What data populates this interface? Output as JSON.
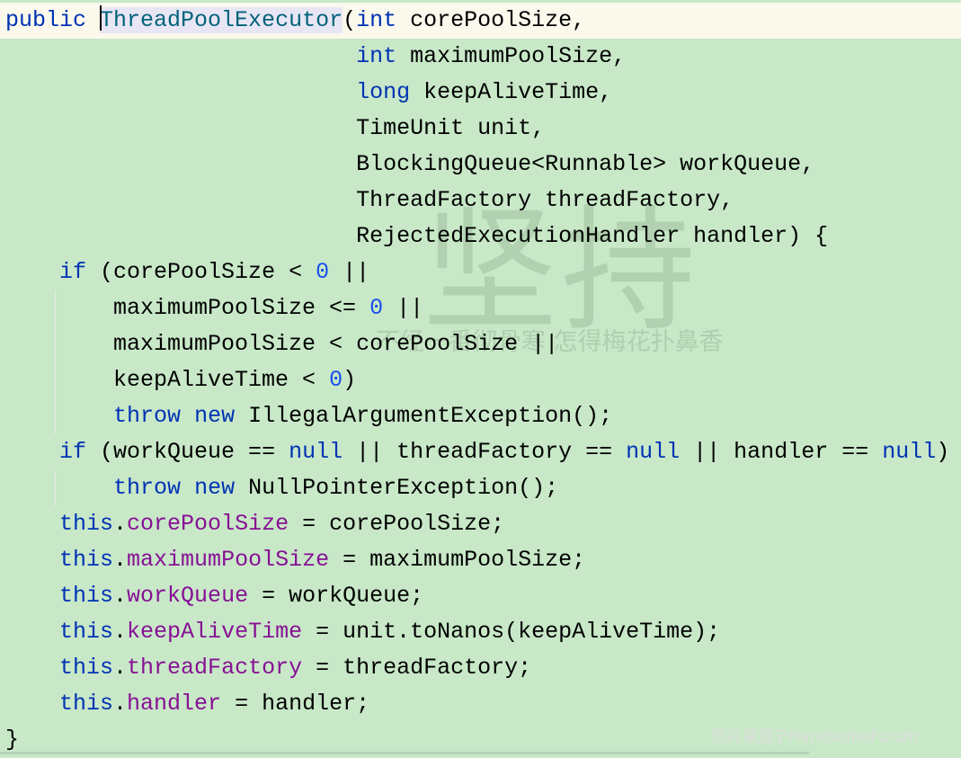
{
  "colors": {
    "background": "#c8e8c8",
    "current_line": "#fbf8ec",
    "selection": "#e8e6f4",
    "keyword": "#0033b3",
    "class_name": "#00627a",
    "number": "#1750eb",
    "field": "#871094"
  },
  "watermark": {
    "big": "坚持",
    "poem": "不经一番彻骨寒 怎得梅花扑鼻香",
    "source": "图片来源于HandsomeForum"
  },
  "code": [
    [
      {
        "t": "public",
        "c": "kw"
      },
      {
        "t": " "
      },
      {
        "t": "",
        "c": "caret"
      },
      {
        "t": "ThreadPoolExecutor",
        "c": "cls sel"
      },
      {
        "t": "("
      },
      {
        "t": "int",
        "c": "kw"
      },
      {
        "t": " corePoolSize,"
      }
    ],
    [
      {
        "t": "                          "
      },
      {
        "t": "int",
        "c": "kw"
      },
      {
        "t": " maximumPoolSize,"
      }
    ],
    [
      {
        "t": "                          "
      },
      {
        "t": "long",
        "c": "kw"
      },
      {
        "t": " keepAliveTime,"
      }
    ],
    [
      {
        "t": "                          TimeUnit unit,"
      }
    ],
    [
      {
        "t": "                          BlockingQueue<Runnable> workQueue,"
      }
    ],
    [
      {
        "t": "                          ThreadFactory threadFactory,"
      }
    ],
    [
      {
        "t": "                          RejectedExecutionHandler handler) {"
      }
    ],
    [
      {
        "t": "    "
      },
      {
        "t": "if",
        "c": "kw"
      },
      {
        "t": " (corePoolSize < "
      },
      {
        "t": "0",
        "c": "num"
      },
      {
        "t": " ||"
      }
    ],
    [
      {
        "t": "        maximumPoolSize <= "
      },
      {
        "t": "0",
        "c": "num"
      },
      {
        "t": " ||"
      }
    ],
    [
      {
        "t": "        maximumPoolSize < corePoolSize ||"
      }
    ],
    [
      {
        "t": "        keepAliveTime < "
      },
      {
        "t": "0",
        "c": "num"
      },
      {
        "t": ")"
      }
    ],
    [
      {
        "t": "        "
      },
      {
        "t": "throw",
        "c": "kw"
      },
      {
        "t": " "
      },
      {
        "t": "new",
        "c": "kw"
      },
      {
        "t": " IllegalArgumentException();"
      }
    ],
    [
      {
        "t": "    "
      },
      {
        "t": "if",
        "c": "kw"
      },
      {
        "t": " (workQueue == "
      },
      {
        "t": "null",
        "c": "kw"
      },
      {
        "t": " || threadFactory == "
      },
      {
        "t": "null",
        "c": "kw"
      },
      {
        "t": " || handler == "
      },
      {
        "t": "null",
        "c": "kw"
      },
      {
        "t": ")"
      }
    ],
    [
      {
        "t": "        "
      },
      {
        "t": "throw",
        "c": "kw"
      },
      {
        "t": " "
      },
      {
        "t": "new",
        "c": "kw"
      },
      {
        "t": " NullPointerException();"
      }
    ],
    [
      {
        "t": "    "
      },
      {
        "t": "this",
        "c": "kw"
      },
      {
        "t": "."
      },
      {
        "t": "corePoolSize",
        "c": "fld"
      },
      {
        "t": " = corePoolSize;"
      }
    ],
    [
      {
        "t": "    "
      },
      {
        "t": "this",
        "c": "kw"
      },
      {
        "t": "."
      },
      {
        "t": "maximumPoolSize",
        "c": "fld"
      },
      {
        "t": " = maximumPoolSize;"
      }
    ],
    [
      {
        "t": "    "
      },
      {
        "t": "this",
        "c": "kw"
      },
      {
        "t": "."
      },
      {
        "t": "workQueue",
        "c": "fld"
      },
      {
        "t": " = workQueue;"
      }
    ],
    [
      {
        "t": "    "
      },
      {
        "t": "this",
        "c": "kw"
      },
      {
        "t": "."
      },
      {
        "t": "keepAliveTime",
        "c": "fld"
      },
      {
        "t": " = unit.toNanos(keepAliveTime);"
      }
    ],
    [
      {
        "t": "    "
      },
      {
        "t": "this",
        "c": "kw"
      },
      {
        "t": "."
      },
      {
        "t": "threadFactory",
        "c": "fld"
      },
      {
        "t": " = threadFactory;"
      }
    ],
    [
      {
        "t": "    "
      },
      {
        "t": "this",
        "c": "kw"
      },
      {
        "t": "."
      },
      {
        "t": "handler",
        "c": "fld"
      },
      {
        "t": " = handler;"
      }
    ],
    [
      {
        "t": "}"
      }
    ]
  ]
}
